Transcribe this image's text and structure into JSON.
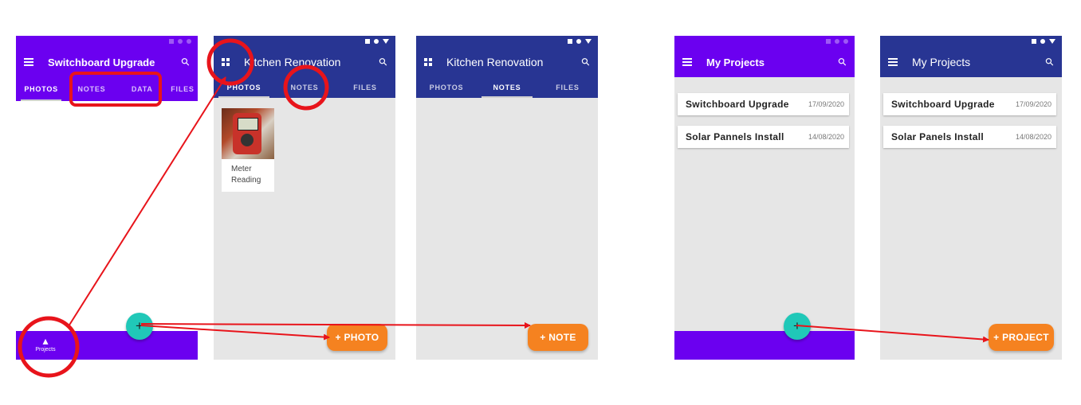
{
  "screen1": {
    "title": "Switchboard Upgrade",
    "tabs": [
      "PHOTOS",
      "NOTES",
      "DATA",
      "FILES"
    ],
    "nav_label": "Projects",
    "fab_symbol": "+",
    "icons": [
      "menu-icon",
      "search-icon",
      "eiffel-tower-icon"
    ]
  },
  "screen2": {
    "title": "Kitchen Renovation",
    "tabs": [
      "PHOTOS",
      "NOTES",
      "FILES"
    ],
    "photo_caption": "Meter Reading",
    "fab_label": "+ PHOTO",
    "icons": [
      "grid-icon",
      "search-icon"
    ]
  },
  "screen3": {
    "title": "Kitchen Renovation",
    "tabs": [
      "PHOTOS",
      "NOTES",
      "FILES"
    ],
    "fab_label": "+ NOTE",
    "icons": [
      "grid-icon",
      "search-icon"
    ]
  },
  "screen4": {
    "title": "My Projects",
    "projects": [
      {
        "name": "Switchboard Upgrade",
        "date": "17/09/2020"
      },
      {
        "name": "Solar Pannels Install",
        "date": "14/08/2020"
      }
    ],
    "fab_symbol": "+",
    "icons": [
      "menu-icon",
      "search-icon"
    ]
  },
  "screen5": {
    "title": "My Projects",
    "projects": [
      {
        "name": "Switchboard Upgrade",
        "date": "17/09/2020"
      },
      {
        "name": "Solar Panels Install",
        "date": "14/08/2020"
      }
    ],
    "fab_label": "+ PROJECT",
    "icons": [
      "menu-icon",
      "search-icon"
    ]
  },
  "colors": {
    "purple": "#6b00f0",
    "indigo": "#283593",
    "fab_orange": "#f58220",
    "fab_teal": "#20c8b8",
    "annotation_red": "#e8141b"
  }
}
